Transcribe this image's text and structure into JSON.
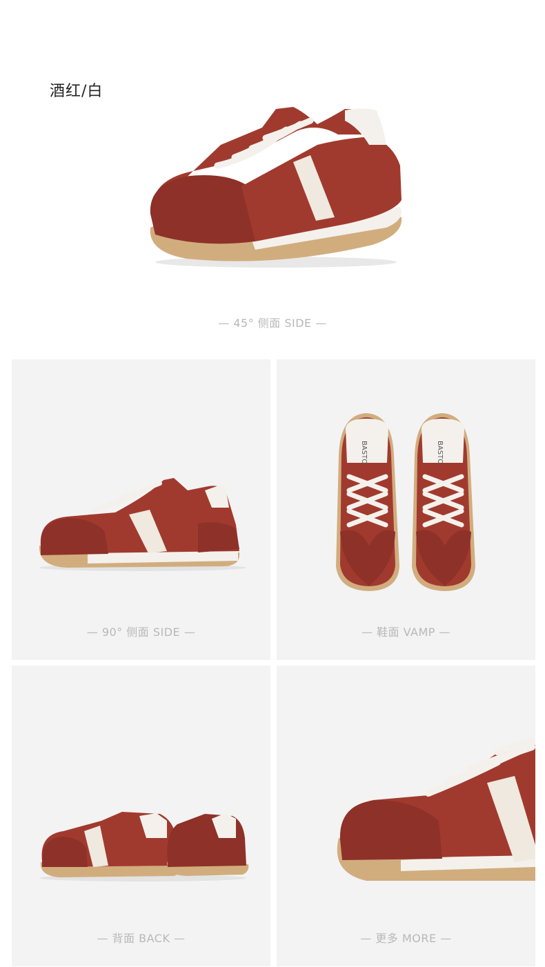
{
  "color_name": "酒红/白",
  "views": [
    {
      "caption": "— 45°  侧面 SIDE —"
    },
    {
      "caption": "— 90°  侧面 SIDE —"
    },
    {
      "caption": "— 鞋面 VAMP —"
    },
    {
      "caption": "— 背面 BACK —"
    },
    {
      "caption": "— 更多 MORE —"
    }
  ],
  "tongue_brand_text": "BASTO",
  "colors": {
    "suede": "#8e3129",
    "nylon": "#a13a2e",
    "stripe": "#efe9df",
    "sole": "#d1ad7e",
    "midsole": "#f4f1ec"
  }
}
